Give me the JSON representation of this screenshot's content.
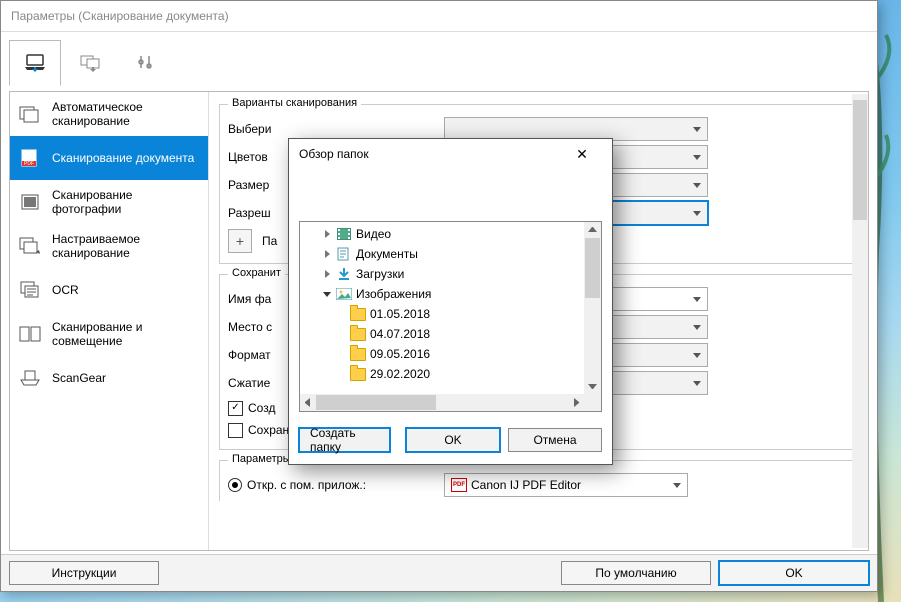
{
  "main_window": {
    "title": "Параметры (Сканирование документа)"
  },
  "sidebar": {
    "items": [
      {
        "label": "Автоматическое сканирование"
      },
      {
        "label": "Сканирование документа"
      },
      {
        "label": "Сканирование фотографии"
      },
      {
        "label": "Настраиваемое сканирование"
      },
      {
        "label": "OCR"
      },
      {
        "label": "Сканирование и совмещение"
      },
      {
        "label": "ScanGear"
      }
    ]
  },
  "scan_opts": {
    "group_title": "Варианты сканирования",
    "rows": {
      "select": "Выбери",
      "color": "Цветов",
      "size": "Размер",
      "res": "Разреш",
      "plus_lbl": "Па"
    }
  },
  "save_opts": {
    "group_title": "Сохранит",
    "rows": {
      "name": "Имя фа",
      "loc": "Место с",
      "fmt": "Формат",
      "comp": "Сжатие"
    },
    "chk1": "Созд",
    "chk2": "Сохранение в подпапку с текущей датой"
  },
  "app_opts": {
    "group_title": "Параметры приложения",
    "radio_lbl": "Откр. с пом. прилож.:",
    "app_name": "Canon IJ PDF Editor"
  },
  "footer": {
    "instr": "Инструкции",
    "defaults": "По умолчанию",
    "ok": "OK"
  },
  "dialog": {
    "title": "Обзор папок",
    "tree": {
      "video": "Видео",
      "docs": "Документы",
      "down": "Загрузки",
      "img": "Изображения",
      "f1": "01.05.2018",
      "f2": "04.07.2018",
      "f3": "09.05.2016",
      "f4": "29.02.2020"
    },
    "btns": {
      "new": "Создать папку",
      "ok": "OK",
      "cancel": "Отмена"
    }
  }
}
